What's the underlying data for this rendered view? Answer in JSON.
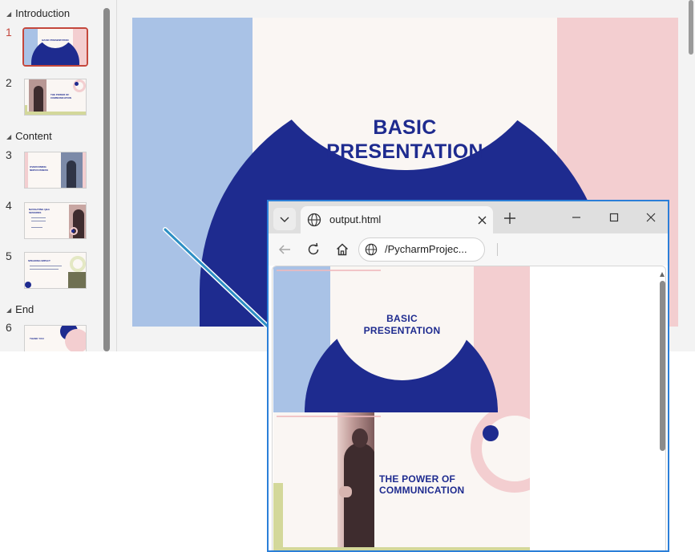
{
  "thumbnail_panel": {
    "sections": [
      {
        "name": "Introduction"
      },
      {
        "name": "Content"
      },
      {
        "name": "End"
      }
    ],
    "slides": [
      {
        "number": "1",
        "thumb_text": "BASIC PRESENTATION"
      },
      {
        "number": "2",
        "thumb_text": "THE POWER OF COMMUNICATION"
      },
      {
        "number": "3",
        "thumb_text": "OVERCOMING NERVOUSNESS"
      },
      {
        "number": "4",
        "thumb_text": "NAVIGATING Q&A SESSIONS"
      },
      {
        "number": "5",
        "thumb_text": "SPEAKING IMPACT"
      },
      {
        "number": "6",
        "thumb_text": "THANK YOU"
      }
    ],
    "selected_slide": "1"
  },
  "main_slide": {
    "title": "BASIC\nPRESENTATION",
    "colors": {
      "blue": "#a9c2e6",
      "pink": "#f3ced0",
      "navy": "#1e2b8f",
      "cream": "#faf6f3"
    }
  },
  "browser": {
    "tab_title": "output.html",
    "url": "/PycharmProjec...",
    "rendered_slides": [
      {
        "title": "BASIC\nPRESENTATION"
      },
      {
        "title": "THE POWER OF\nCOMMUNICATION"
      }
    ]
  },
  "icons": {
    "tab_list": "chevron-down-icon",
    "favicon": "globe-icon",
    "close_tab": "close-icon",
    "new_tab": "plus-icon",
    "minimize": "minimize-icon",
    "maximize": "maximize-icon",
    "close_window": "close-icon",
    "back": "back-arrow-icon",
    "reload": "reload-icon",
    "home": "home-icon"
  }
}
